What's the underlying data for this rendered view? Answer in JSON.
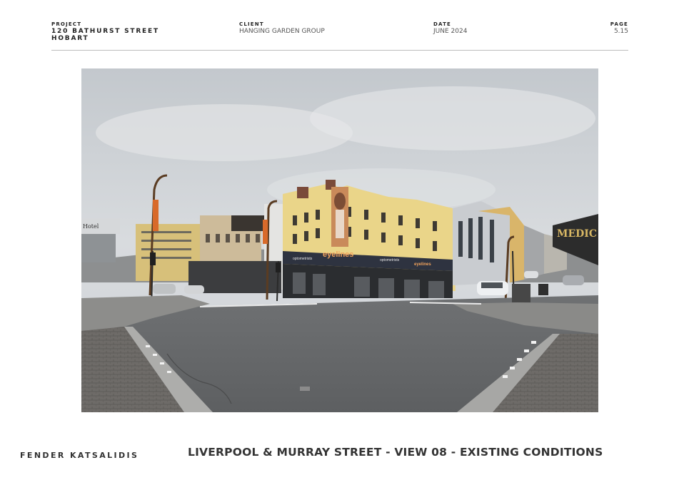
{
  "header": {
    "project": {
      "label": "PROJECT",
      "line1": "120 BATHURST STREET",
      "line2": "HOBART"
    },
    "client": {
      "label": "CLIENT",
      "value": "HANGING GARDEN GROUP"
    },
    "date": {
      "label": "DATE",
      "value": "JUNE 2024"
    },
    "page": {
      "label": "PAGE",
      "value": "5.15"
    }
  },
  "photo": {
    "signs": {
      "shop": "eyelines",
      "optometrists": "optometrists",
      "optometrists2": "optometrists",
      "medical": "MEDIC",
      "hotel": "Hotel",
      "corner": "eyelines"
    }
  },
  "footer": {
    "firm": "FENDER KATSALIDIS",
    "view_title": "LIVERPOOL & MURRAY STREET - VIEW 08 - EXISTING CONDITIONS"
  }
}
